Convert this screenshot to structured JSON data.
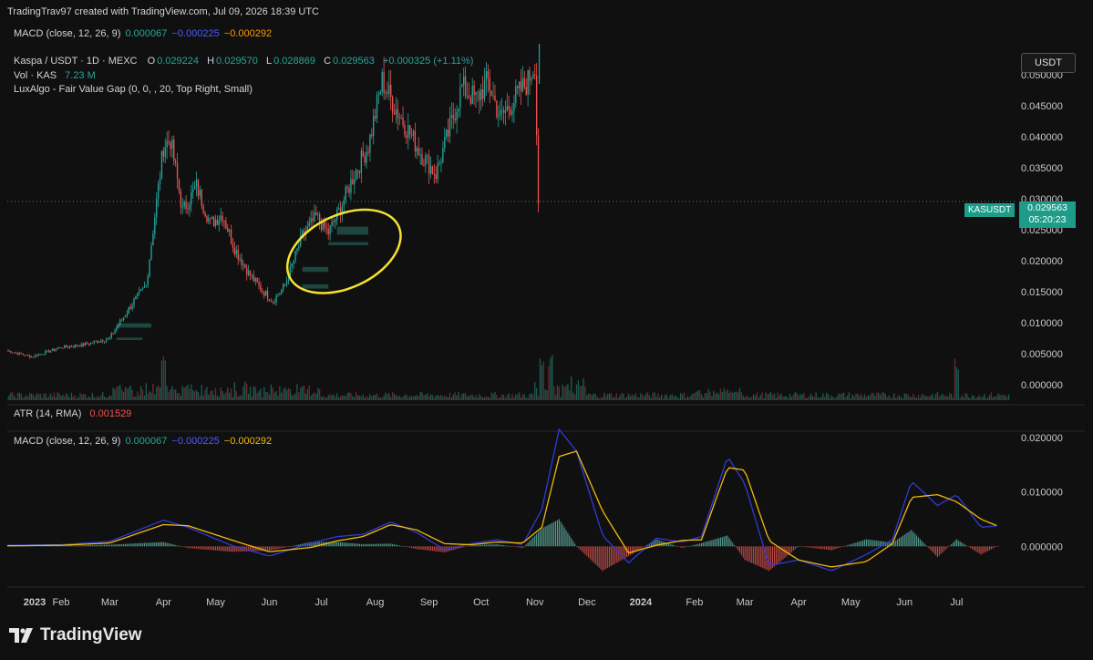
{
  "attribution": "TradingTrav97 created with TradingView.com, Jul 09, 2026 18:39 UTC",
  "brand": "TradingView",
  "colors": {
    "up": "#26a69a",
    "down": "#ef5350",
    "macd": "#2f3bd6",
    "signal": "#f0b90b",
    "fvg": "#1e4d45",
    "annotation": "#f5e12f",
    "background": "#101010"
  },
  "top_legend": {
    "macd_label": "MACD (close, 12, 26, 9)",
    "macd_value": "0.000067",
    "signal_value": "−0.000225",
    "hist_value": "−0.000292"
  },
  "price_legend": {
    "symbol": "Kaspa / USDT · 1D · MEXC",
    "o_label": "O",
    "o_value": "0.029224",
    "h_label": "H",
    "h_value": "0.029570",
    "l_label": "L",
    "l_value": "0.028869",
    "c_label": "C",
    "c_value": "0.029563",
    "change": "+0.000325 (+1.11%)",
    "vol_label": "Vol · KAS",
    "vol_value": "7.23 M",
    "indicator": "LuxAlgo - Fair Value Gap (0, 0, , 20, Top Right, Small)"
  },
  "atr_legend": {
    "label": "ATR (14, RMA)",
    "value": "0.001529"
  },
  "macd_legend": {
    "label": "MACD (close, 12, 26, 9)",
    "macd_value": "0.000067",
    "signal_value": "−0.000225",
    "hist_value": "−0.000292"
  },
  "price_axis": {
    "currency": "USDT",
    "current_symbol": "KASUSDT",
    "current_price": "0.029563",
    "countdown": "05:20:23"
  },
  "chart_data": [
    {
      "type": "line",
      "title": "Kaspa / USDT · 1D · MEXC",
      "xlabel": "",
      "ylabel": "",
      "x_ticks": [
        "2023",
        "Feb",
        "Mar",
        "Apr",
        "May",
        "Jun",
        "Jul",
        "Aug",
        "Sep",
        "Oct",
        "Nov",
        "Dec",
        "2024",
        "Feb",
        "Mar",
        "Apr",
        "May",
        "Jun",
        "Jul"
      ],
      "y_ticks": [
        "0.000000",
        "0.005000",
        "0.010000",
        "0.015000",
        "0.020000",
        "0.025000",
        "0.030000",
        "0.035000",
        "0.040000",
        "0.045000",
        "0.050000"
      ],
      "ylim": [
        0,
        0.055
      ],
      "series": [
        {
          "name": "close",
          "x": [
            "2023-01-01",
            "2023-01-15",
            "2023-02-01",
            "2023-02-15",
            "2023-03-01",
            "2023-03-08",
            "2023-03-15",
            "2023-03-22",
            "2023-04-01",
            "2023-04-05",
            "2023-04-12",
            "2023-04-20",
            "2023-04-28",
            "2023-05-05",
            "2023-05-12",
            "2023-05-20",
            "2023-05-27",
            "2023-06-03",
            "2023-06-10",
            "2023-06-20",
            "2023-06-28",
            "2023-07-05",
            "2023-07-12",
            "2023-07-20",
            "2023-07-28",
            "2023-08-05",
            "2023-08-12",
            "2023-08-20",
            "2023-08-28",
            "2023-09-05",
            "2023-09-12",
            "2023-09-20",
            "2023-09-28",
            "2023-10-05",
            "2023-10-12",
            "2023-10-20",
            "2023-10-28",
            "2023-11-01",
            "2023-11-03"
          ],
          "values": [
            0.0055,
            0.0045,
            0.006,
            0.0065,
            0.0075,
            0.0105,
            0.0135,
            0.016,
            0.0385,
            0.0395,
            0.028,
            0.032,
            0.026,
            0.0275,
            0.022,
            0.018,
            0.0155,
            0.0135,
            0.016,
            0.024,
            0.027,
            0.0245,
            0.0285,
            0.034,
            0.0385,
            0.049,
            0.045,
            0.041,
            0.037,
            0.034,
            0.0405,
            0.048,
            0.046,
            0.049,
            0.043,
            0.046,
            0.049,
            0.052,
            0.0296
          ]
        }
      ],
      "volume_series": {
        "name": "Vol · KAS",
        "peaks": [
          "2023-04-01",
          "2023-11-05",
          "2023-11-10",
          "2024-07-01"
        ]
      },
      "fvg_zones": [
        {
          "from": "2023-03-05",
          "to": "2023-03-25",
          "low": 0.0092,
          "high": 0.0099
        },
        {
          "from": "2023-03-05",
          "to": "2023-03-20",
          "low": 0.0072,
          "high": 0.0076
        },
        {
          "from": "2023-06-20",
          "to": "2023-07-05",
          "low": 0.0155,
          "high": 0.0162
        },
        {
          "from": "2023-06-20",
          "to": "2023-07-05",
          "low": 0.0182,
          "high": 0.019
        },
        {
          "from": "2023-07-05",
          "to": "2023-07-28",
          "low": 0.0225,
          "high": 0.023
        },
        {
          "from": "2023-07-10",
          "to": "2023-07-28",
          "low": 0.0242,
          "high": 0.0255
        }
      ]
    },
    {
      "type": "line",
      "title": "MACD (close, 12, 26, 9)",
      "y_ticks": [
        "0.000000",
        "0.010000",
        "0.020000"
      ],
      "ylim": [
        -0.0048,
        0.022
      ],
      "x": [
        "2023-01-01",
        "2023-02-01",
        "2023-03-01",
        "2023-04-01",
        "2023-04-15",
        "2023-05-10",
        "2023-06-01",
        "2023-06-25",
        "2023-07-10",
        "2023-07-25",
        "2023-08-10",
        "2023-08-25",
        "2023-09-10",
        "2023-09-25",
        "2023-10-10",
        "2023-10-25",
        "2023-11-05",
        "2023-11-15",
        "2023-11-25",
        "2023-12-10",
        "2023-12-25",
        "2024-01-10",
        "2024-01-25",
        "2024-02-05",
        "2024-02-20",
        "2024-03-01",
        "2024-03-15",
        "2024-04-01",
        "2024-04-20",
        "2024-05-10",
        "2024-05-25",
        "2024-06-05",
        "2024-06-20",
        "2024-07-01",
        "2024-07-15",
        "2024-07-25"
      ],
      "series": [
        {
          "name": "MACD",
          "values": [
            0.0002,
            0.0003,
            0.0009,
            0.0048,
            0.0035,
            0.0002,
            -0.0018,
            0.0006,
            0.0018,
            0.0022,
            0.0045,
            0.0025,
            -0.0006,
            0.0005,
            0.0012,
            0.0003,
            0.0068,
            0.0215,
            0.0175,
            0.002,
            -0.003,
            0.0015,
            0.0008,
            0.0018,
            0.0165,
            0.0115,
            -0.0035,
            -0.0025,
            -0.0045,
            -0.0015,
            0.0012,
            0.012,
            0.0075,
            0.0095,
            0.0035,
            0.0038
          ]
        },
        {
          "name": "Signal",
          "values": [
            0.0001,
            0.0002,
            0.0006,
            0.004,
            0.0038,
            0.0012,
            -0.001,
            -0.0002,
            0.001,
            0.0018,
            0.004,
            0.003,
            0.0005,
            0.0003,
            0.0008,
            0.0006,
            0.0035,
            0.0165,
            0.0175,
            0.0065,
            -0.0012,
            0.0002,
            0.0011,
            0.0012,
            0.0145,
            0.014,
            0.001,
            -0.0025,
            -0.0038,
            -0.0028,
            0.0005,
            0.009,
            0.0095,
            0.0082,
            0.005,
            0.0037
          ]
        }
      ]
    }
  ]
}
